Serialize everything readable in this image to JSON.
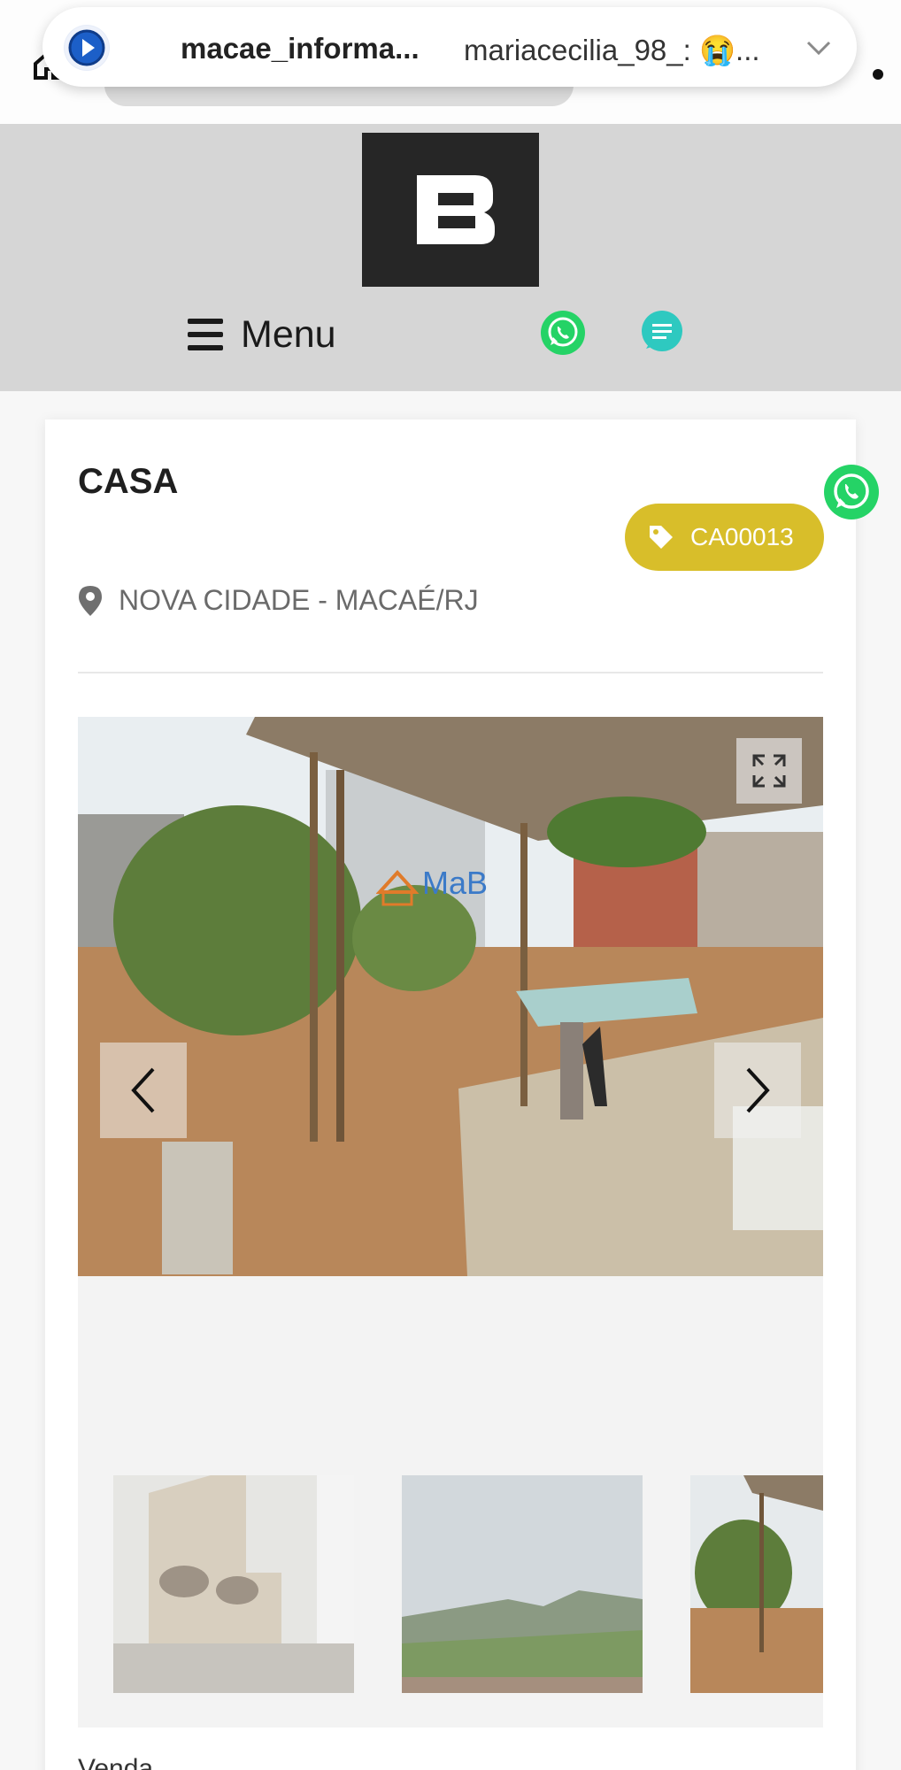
{
  "notification": {
    "sender": "macae_informa...",
    "message": "mariacecilia_98_: 😭...",
    "icons": {
      "app": "app-logo-icon",
      "expand": "chevron-down-icon"
    }
  },
  "header": {
    "menu_label": "Menu",
    "icons": {
      "menu": "hamburger-icon",
      "whatsapp": "whatsapp-icon",
      "chat": "chat-icon"
    },
    "colors": {
      "whatsapp": "#25d366",
      "chat": "#2ec9c0",
      "logo_bg": "#262626"
    }
  },
  "listing": {
    "title": "CASA",
    "code": "CA00013",
    "location": "NOVA CIDADE - MACAÉ/RJ",
    "purpose": "Venda",
    "colors": {
      "badge": "#d8be2a"
    }
  },
  "gallery": {
    "watermark": "MaB"
  }
}
